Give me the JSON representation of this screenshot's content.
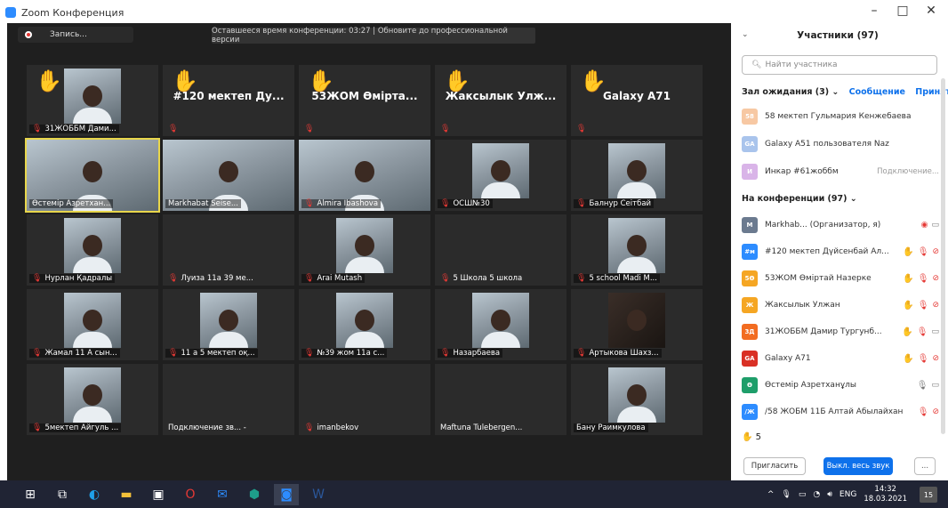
{
  "window": {
    "title": "Zoom Конференция",
    "minimize": "–",
    "maximize": "□",
    "close": "✕"
  },
  "toolbar": {
    "record_label": "Запись...",
    "banner": "Оставшееся время конференции: 03:27 | Обновите до профессиональной версии"
  },
  "colors": {
    "meeting_bg": "#1f1f1f",
    "tile_bg": "#2b2b2b",
    "accent": "#0e71eb",
    "hand": "#f5b52b",
    "muted": "#e53935",
    "active_speaker": "#e8d64b"
  },
  "tiles": [
    {
      "name": "31ЖОББМ Дами...",
      "hand": true,
      "video": true,
      "muted": true
    },
    {
      "name": "",
      "big_name": "#120 мектеп Ду...",
      "hand": true,
      "video": false,
      "muted": true
    },
    {
      "name": "",
      "big_name": "53ЖОМ Өміртa...",
      "hand": true,
      "video": false,
      "muted": true
    },
    {
      "name": "",
      "big_name": "Жаксылык Улж...",
      "hand": true,
      "video": false,
      "muted": true
    },
    {
      "name": "",
      "big_name": "Galaxy A71",
      "hand": true,
      "video": false,
      "muted": true
    },
    {
      "name": "Өстемір Азретхан...",
      "hand": false,
      "video": true,
      "wide": true,
      "muted": false,
      "active": true
    },
    {
      "name": "Markhabat Seise...",
      "hand": false,
      "video": true,
      "wide": true,
      "muted": false
    },
    {
      "name": "Almira Ibashova",
      "hand": false,
      "video": true,
      "wide": true,
      "muted": true
    },
    {
      "name": "ОСШ№30",
      "hand": false,
      "video": true,
      "muted": true
    },
    {
      "name": "Балнур Сеітбай",
      "hand": false,
      "video": true,
      "muted": true
    },
    {
      "name": "Нурлан Қадралы",
      "hand": false,
      "video": true,
      "muted": true
    },
    {
      "name": "Луиза 11а 39 ме...",
      "hand": false,
      "video": false,
      "muted": true
    },
    {
      "name": "Arai Mutash",
      "hand": false,
      "video": true,
      "muted": true
    },
    {
      "name": "5 Школа 5 школа",
      "hand": false,
      "video": false,
      "muted": true
    },
    {
      "name": "5 school Madi M...",
      "hand": false,
      "video": true,
      "muted": true
    },
    {
      "name": "Жамал 11 А сын...",
      "hand": false,
      "video": true,
      "muted": true
    },
    {
      "name": "11 а 5 мектеп оқ...",
      "hand": false,
      "video": true,
      "muted": true
    },
    {
      "name": "№39 жом 11а с...",
      "hand": false,
      "video": true,
      "muted": true
    },
    {
      "name": "Назарбаева",
      "hand": false,
      "video": true,
      "muted": true
    },
    {
      "name": "Артыкова Шахз...",
      "hand": false,
      "video": true,
      "dark": true,
      "muted": true
    },
    {
      "name": "5мектеп Айгуль ...",
      "hand": false,
      "video": true,
      "muted": true
    },
    {
      "name": "Подключение зв... -",
      "hand": false,
      "video": false,
      "muted": false
    },
    {
      "name": "imanbekov",
      "hand": false,
      "video": false,
      "muted": true
    },
    {
      "name": "Maftuna Tulebergen...",
      "hand": false,
      "video": false,
      "muted": false
    },
    {
      "name": "Бану Раимкулова",
      "hand": false,
      "video": true,
      "muted": false
    }
  ],
  "panel": {
    "collapse_icon": "⌄",
    "title": "Участники (97)",
    "search_placeholder": "Найти участника",
    "waiting_header": "Зал ожидания (3)",
    "waiting_message": "Сообщение",
    "waiting_accept": "Приняти",
    "waiting": [
      {
        "initials": "58",
        "name": "58 мектеп Гульмария Кенжебаева",
        "color": "#f7c8a3",
        "status": ""
      },
      {
        "initials": "GA",
        "name": "Galaxy A51 пользователя Naz",
        "color": "#a9c4ec",
        "status": ""
      },
      {
        "initials": "И",
        "name": "Инкар #61жоббм",
        "color": "#d9b4e8",
        "status": "Подключение..."
      }
    ],
    "conference_header": "На конференции (97)",
    "participants": [
      {
        "initials": "M",
        "name": "Markhab... (Организатор, я)",
        "color": "#6b7a8f",
        "icons": [
          "rec",
          "cam"
        ]
      },
      {
        "initials": "#м",
        "name": "#120 мектеп Дүйсенбай Ал...",
        "color": "#2d8cff",
        "icons": [
          "hand",
          "mic",
          "camoff"
        ]
      },
      {
        "initials": "5Ө",
        "name": "53ЖОМ Өміртай Назерке",
        "color": "#f5a623",
        "icons": [
          "hand",
          "mic",
          "camoff"
        ]
      },
      {
        "initials": "Ж",
        "name": "Жаксылык Улжан",
        "color": "#f5a623",
        "icons": [
          "hand",
          "mic",
          "camoff"
        ]
      },
      {
        "initials": "3Д",
        "name": "31ЖОББМ Дамир Тургунб...",
        "color": "#f26c21",
        "icons": [
          "hand",
          "mic",
          "cam"
        ]
      },
      {
        "initials": "GA",
        "name": "Galaxy A71",
        "color": "#d93025",
        "icons": [
          "hand",
          "mic",
          "camoff"
        ]
      },
      {
        "initials": "Ө",
        "name": "Өстемір Азретханұлы",
        "color": "#1e9e6a",
        "icons": [
          "micon",
          "cam"
        ]
      },
      {
        "initials": "/Ж",
        "name": "/58 ЖОБМ 11Б Алтай Абылайхан",
        "color": "#2d8cff",
        "icons": [
          "mic",
          "camoff"
        ]
      }
    ],
    "hands_count": "5",
    "invite_label": "Пригласить",
    "mute_all_label": "Выкл. весь звук",
    "more_label": "..."
  },
  "taskbar": {
    "apps": [
      "windows-icon",
      "taskview-icon",
      "edge-icon",
      "explorer-icon",
      "store-icon",
      "opera-icon",
      "mail-icon",
      "app-icon",
      "zoom-icon",
      "word-icon"
    ],
    "lang": "ENG",
    "time": "14:32",
    "date": "18.03.2021",
    "notifications": "15"
  }
}
